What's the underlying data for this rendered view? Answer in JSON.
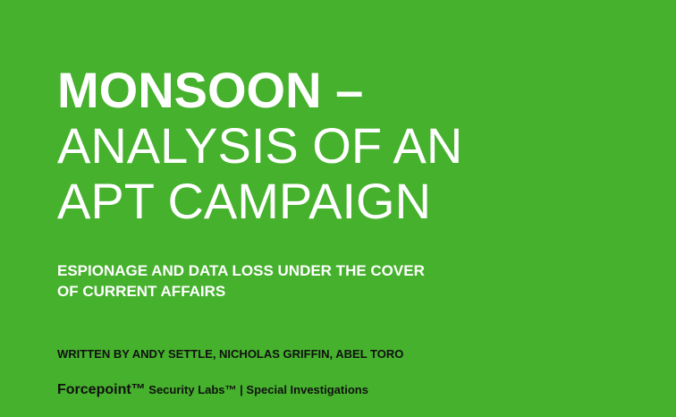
{
  "cover": {
    "title_line1": "MONSOON –",
    "title_line2": "ANALYSIS OF AN",
    "title_line3": "APT CAMPAIGN",
    "subtitle_line1": "ESPIONAGE AND DATA LOSS UNDER THE COVER",
    "subtitle_line2": "OF CURRENT AFFAIRS",
    "authors": "WRITTEN BY ANDY SETTLE, NICHOLAS GRIFFIN, ABEL TORO",
    "footer_brand": "Forcepoint™",
    "footer_rest": " Security Labs™  |  Special Investigations"
  },
  "colors": {
    "background": "#45b12c",
    "title_text": "#ffffff",
    "body_text": "#111111"
  }
}
